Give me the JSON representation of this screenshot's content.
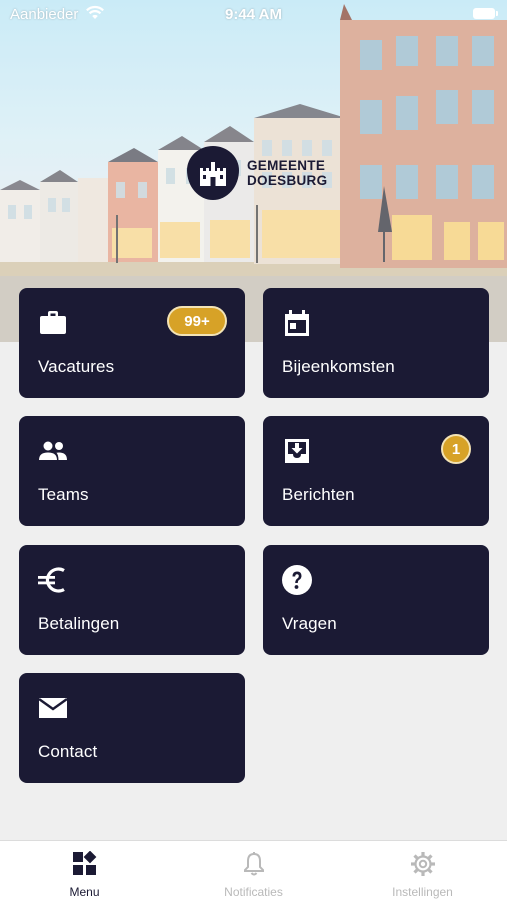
{
  "status_bar": {
    "carrier": "Aanbieder",
    "time": "9:44 AM"
  },
  "header": {
    "logo_line1": "GEMEENTE",
    "logo_line2": "DOESBURG"
  },
  "tiles": [
    {
      "label": "Vacatures",
      "icon": "briefcase-icon",
      "badge": "99+"
    },
    {
      "label": "Bijeenkomsten",
      "icon": "calendar-icon"
    },
    {
      "label": "Teams",
      "icon": "people-icon"
    },
    {
      "label": "Berichten",
      "icon": "inbox-icon",
      "badge": "1"
    },
    {
      "label": "Betalingen",
      "icon": "euro-icon"
    },
    {
      "label": "Vragen",
      "icon": "question-icon"
    },
    {
      "label": "Contact",
      "icon": "envelope-icon"
    }
  ],
  "tab_bar": {
    "tabs": [
      {
        "label": "Menu",
        "icon": "grid-icon",
        "active": true
      },
      {
        "label": "Notificaties",
        "icon": "bell-icon",
        "active": false
      },
      {
        "label": "Instellingen",
        "icon": "gear-icon",
        "active": false
      }
    ]
  },
  "colors": {
    "tile_background": "#1b1a34",
    "badge": "#d7a227",
    "page_background": "#efefef",
    "tab_inactive": "#b9b9b9"
  }
}
